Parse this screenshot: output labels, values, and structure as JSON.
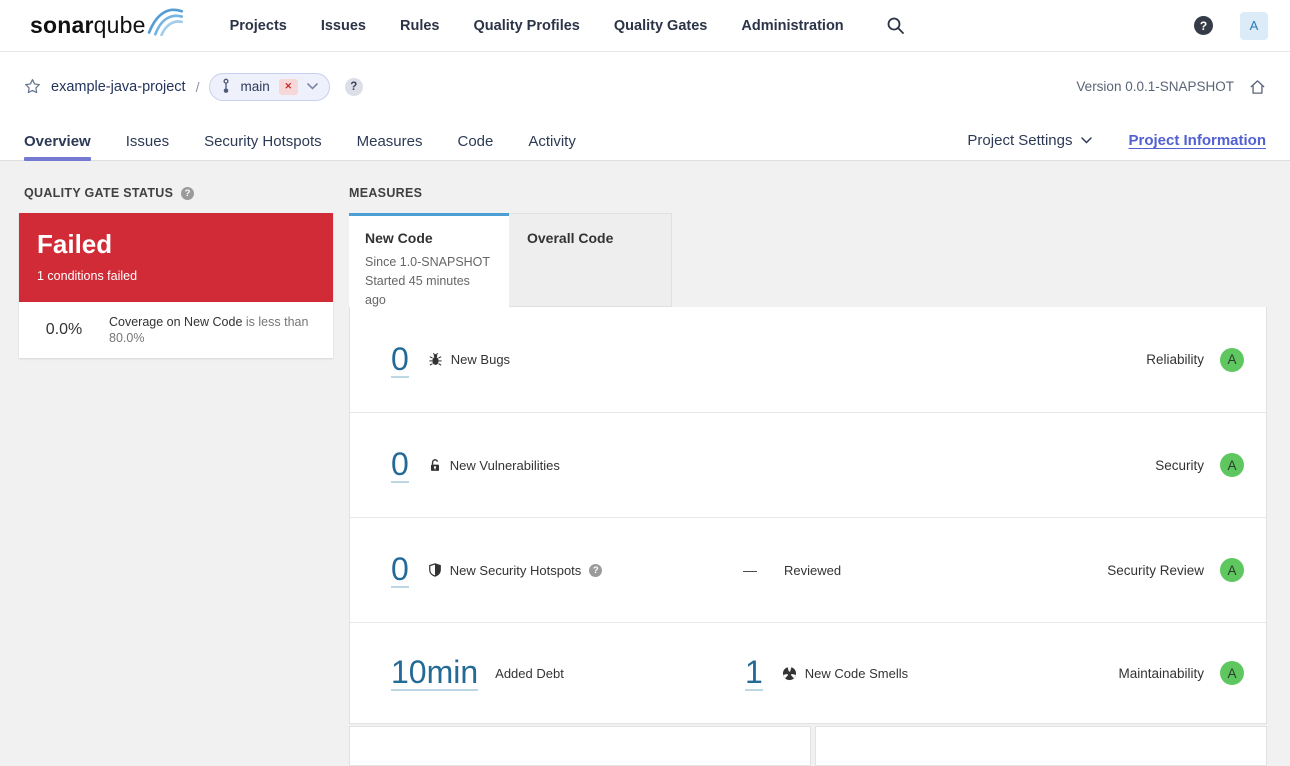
{
  "brand": {
    "bold": "sonar",
    "light": "qube"
  },
  "nav": {
    "items": [
      "Projects",
      "Issues",
      "Rules",
      "Quality Profiles",
      "Quality Gates",
      "Administration"
    ],
    "help_symbol": "?",
    "avatar_initial": "A"
  },
  "breadcrumb": {
    "project": "example-java-project",
    "separator": "/",
    "branch": "main",
    "close_symbol": "✕",
    "help_symbol": "?",
    "version": "Version 0.0.1-SNAPSHOT"
  },
  "tabs": {
    "items": [
      "Overview",
      "Issues",
      "Security Hotspots",
      "Measures",
      "Code",
      "Activity"
    ],
    "active": "Overview",
    "project_settings": "Project Settings",
    "project_information": "Project Information"
  },
  "quality_gate": {
    "title": "QUALITY GATE STATUS",
    "help_symbol": "?",
    "status": "Failed",
    "conditions_failed": "1 conditions failed",
    "condition": {
      "value": "0.0%",
      "metric": "Coverage on New Code",
      "constraint": "is less than 80.0%"
    }
  },
  "measures": {
    "title": "MEASURES",
    "new_code_tab": {
      "label": "New Code",
      "since": "Since 1.0-SNAPSHOT",
      "started": "Started 45 minutes ago"
    },
    "overall_code_tab": {
      "label": "Overall Code"
    },
    "rows": {
      "bugs": {
        "value": "0",
        "label": "New Bugs",
        "rating_label": "Reliability",
        "rating": "A"
      },
      "vulnerabilities": {
        "value": "0",
        "label": "New Vulnerabilities",
        "rating_label": "Security",
        "rating": "A"
      },
      "hotspots": {
        "value": "0",
        "label": "New Security Hotspots",
        "help_symbol": "?",
        "reviewed_value": "—",
        "reviewed_label": "Reviewed",
        "rating_label": "Security Review",
        "rating": "A"
      },
      "maintainability": {
        "debt_value": "10min",
        "debt_label": "Added Debt",
        "smells_value": "1",
        "smells_label": "New Code Smells",
        "rating_label": "Maintainability",
        "rating": "A"
      }
    }
  },
  "colors": {
    "accent_blue": "#4b9fd5",
    "link_blue": "#236a97",
    "failed_red": "#d02b36",
    "rating_a_green": "#5fc75f",
    "active_tab_purple": "#7579d2"
  }
}
